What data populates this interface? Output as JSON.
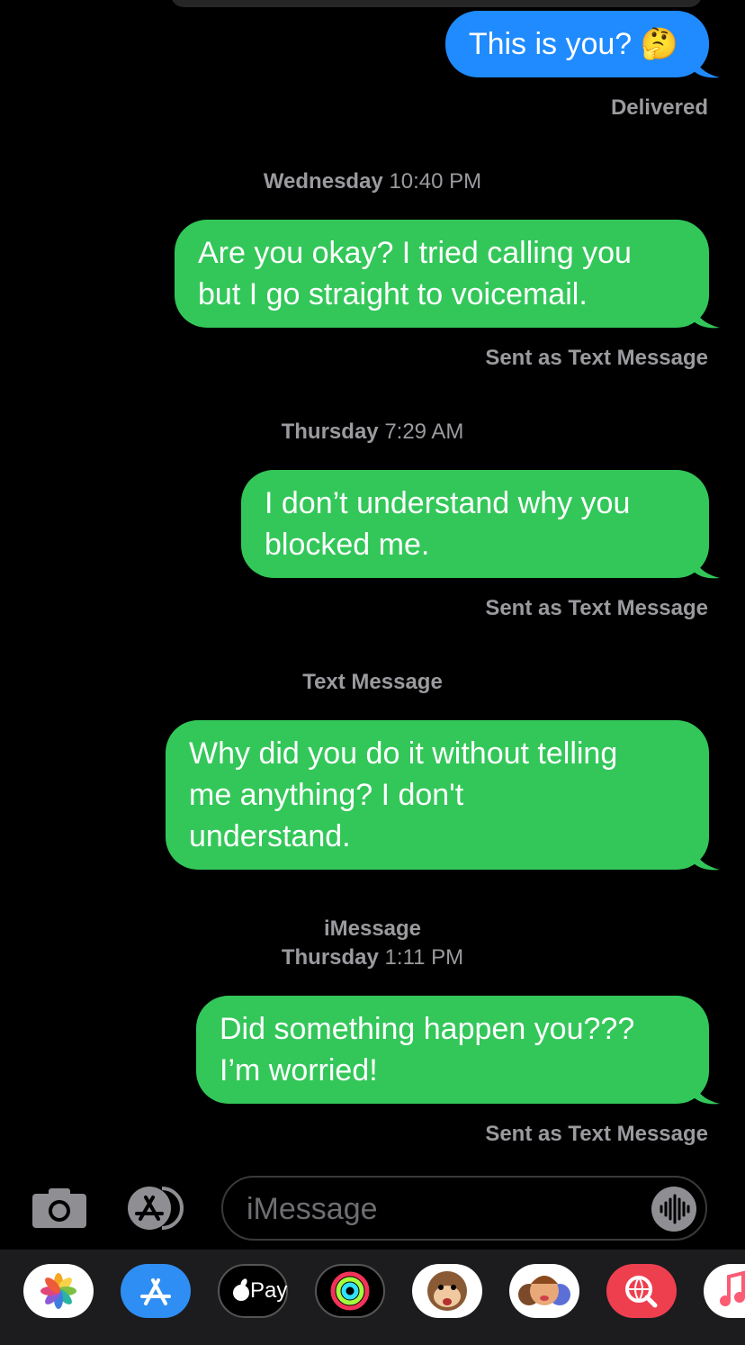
{
  "messages": [
    {
      "text": "This is you? 🤔",
      "color": "blue",
      "status": "Delivered"
    },
    {
      "stamp_day": "Wednesday",
      "stamp_time": "10:40 PM",
      "text_lines": [
        "Are you okay? I tried calling you",
        "but I go straight to voicemail."
      ],
      "color": "green",
      "status": "Sent as Text Message"
    },
    {
      "stamp_day": "Thursday",
      "stamp_time": "7:29 AM",
      "text_lines": [
        "I don’t understand why you",
        "blocked me."
      ],
      "color": "green",
      "status": "Sent as Text Message"
    },
    {
      "stamp_label": "Text Message",
      "text_lines": [
        "Why did you do it without telling",
        "me anything? I don't",
        "understand."
      ],
      "color": "green"
    },
    {
      "stamp_service": "iMessage",
      "stamp_day": "Thursday",
      "stamp_time": "1:11 PM",
      "text_lines": [
        "Did something happen you???",
        "I’m worried!"
      ],
      "color": "green",
      "status": "Sent as Text Message"
    }
  ],
  "composer": {
    "placeholder": "iMessage",
    "camera_icon": "camera-icon",
    "apps_icon": "app-store-icon",
    "mic_icon": "waveform-icon"
  },
  "drawer": {
    "apps": [
      "photos-icon",
      "app-store-icon",
      "apple-pay-icon",
      "activity-icon",
      "monkey-animoji-icon",
      "memoji-icon",
      "web-search-icon",
      "music-icon"
    ],
    "apple_pay_label": "Pay"
  },
  "colors": {
    "blue_bubble": "#1F8BFF",
    "green_bubble": "#33C759",
    "meta_text": "#9a9a9f"
  }
}
